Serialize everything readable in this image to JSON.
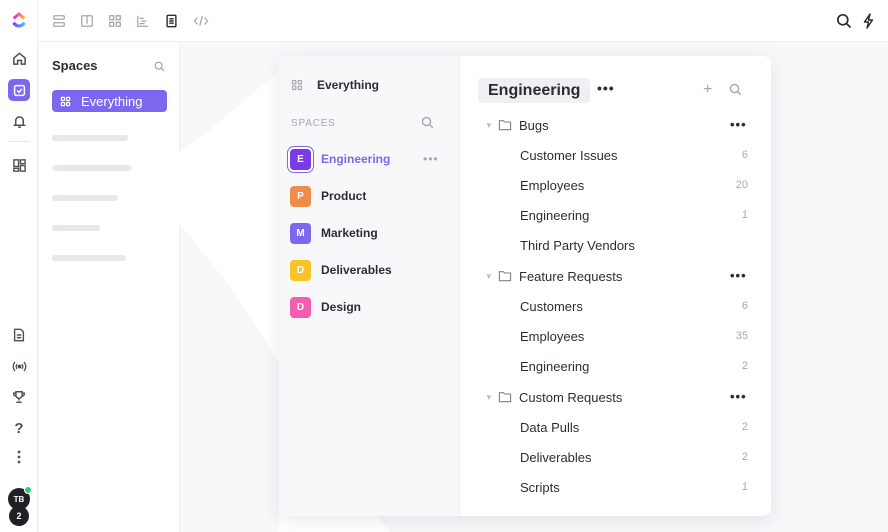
{
  "sidebar": {
    "title": "Spaces",
    "everything_label": "Everything"
  },
  "user": {
    "initials": "TB",
    "badge": "2"
  },
  "panel": {
    "left": {
      "everything_label": "Everything",
      "spaces_header": "SPACES",
      "spaces": [
        {
          "letter": "E",
          "name": "Engineering",
          "color": "#7b3ae8",
          "active": true
        },
        {
          "letter": "P",
          "name": "Product",
          "color": "#f08c4a"
        },
        {
          "letter": "M",
          "name": "Marketing",
          "color": "#7b68ee"
        },
        {
          "letter": "D",
          "name": "Deliverables",
          "color": "#f7c325"
        },
        {
          "letter": "D",
          "name": "Design",
          "color": "#f45db1"
        }
      ]
    },
    "right": {
      "title": "Engineering",
      "folders": [
        {
          "name": "Bugs",
          "lists": [
            {
              "name": "Customer Issues",
              "count": "6"
            },
            {
              "name": "Employees",
              "count": "20"
            },
            {
              "name": "Engineering",
              "count": "1"
            },
            {
              "name": "Third Party Vendors",
              "count": ""
            }
          ]
        },
        {
          "name": "Feature Requests",
          "lists": [
            {
              "name": "Customers",
              "count": "6"
            },
            {
              "name": "Employees",
              "count": "35"
            },
            {
              "name": "Engineering",
              "count": "2"
            }
          ]
        },
        {
          "name": "Custom Requests",
          "lists": [
            {
              "name": "Data Pulls",
              "count": "2"
            },
            {
              "name": "Deliverables",
              "count": "2"
            },
            {
              "name": "Scripts",
              "count": "1"
            }
          ]
        }
      ]
    }
  },
  "colors": {
    "accent": "#7b68ee"
  }
}
